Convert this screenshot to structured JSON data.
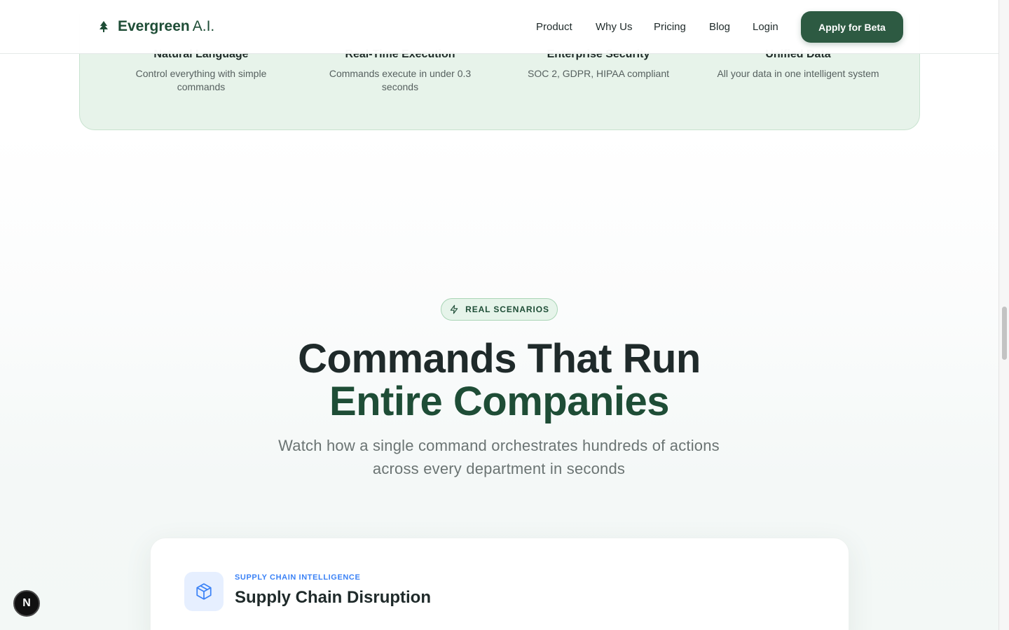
{
  "header": {
    "brand": "Evergreen",
    "brand_suffix": "A.I.",
    "nav": [
      {
        "label": "Product"
      },
      {
        "label": "Why Us"
      },
      {
        "label": "Pricing"
      },
      {
        "label": "Blog"
      },
      {
        "label": "Login"
      }
    ],
    "cta_label": "Apply for Beta"
  },
  "features": [
    {
      "title": "Natural Language",
      "description": "Control everything with simple commands"
    },
    {
      "title": "Real-Time Execution",
      "description": "Commands execute in under 0.3 seconds"
    },
    {
      "title": "Enterprise Security",
      "description": "SOC 2, GDPR, HIPAA compliant"
    },
    {
      "title": "Unified Data",
      "description": "All your data in one intelligent system"
    }
  ],
  "scenarios": {
    "badge": "REAL SCENARIOS",
    "headline_line1": "Commands That Run",
    "headline_line2": "Entire Companies",
    "subtitle": "Watch how a single command orchestrates hundreds of actions across every department in seconds",
    "card": {
      "kicker": "SUPPLY CHAIN INTELLIGENCE",
      "title": "Supply Chain Disruption",
      "icon": "box-icon"
    }
  },
  "dev_badge": "N",
  "colors": {
    "brand_green": "#1e4d36",
    "cta_green": "#2d5a42",
    "feature_band": "#e7f3ea",
    "accent_blue": "#3b82f6"
  }
}
